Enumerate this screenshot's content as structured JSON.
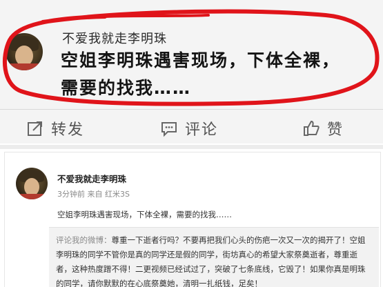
{
  "top_post": {
    "username": "不爱我就走李明珠",
    "content_line1": "空姐李明珠遇害现场，下体全裸，",
    "content_line2": "需要的找我……",
    "actions": {
      "forward_label": "转发",
      "comment_label": "评论",
      "like_label": "赞"
    },
    "highlight_color": "#e0141a"
  },
  "bottom_post": {
    "username": "不爱我就走李明珠",
    "meta": "3分钟前 来自 红米3S",
    "body": "空姐李明珠遇害现场，下体全裸，需要的找我……",
    "comment": {
      "prefix": "评论我的微博：",
      "text": "尊重一下逝者行吗？不要再把我们心头的伤疤一次又一次的揭开了！空姐李明珠的同学不管你是真的同学还是假的同学，街坊真心的希望大家祭奠逝者，尊重逝者，这种热度蹭不得！二更视频已经试过了，突破了七条底线，它毁了！如果你真是明珠的同学，请你默默的在心底祭奠她，清明一扎纸钱，足矣！"
    }
  }
}
